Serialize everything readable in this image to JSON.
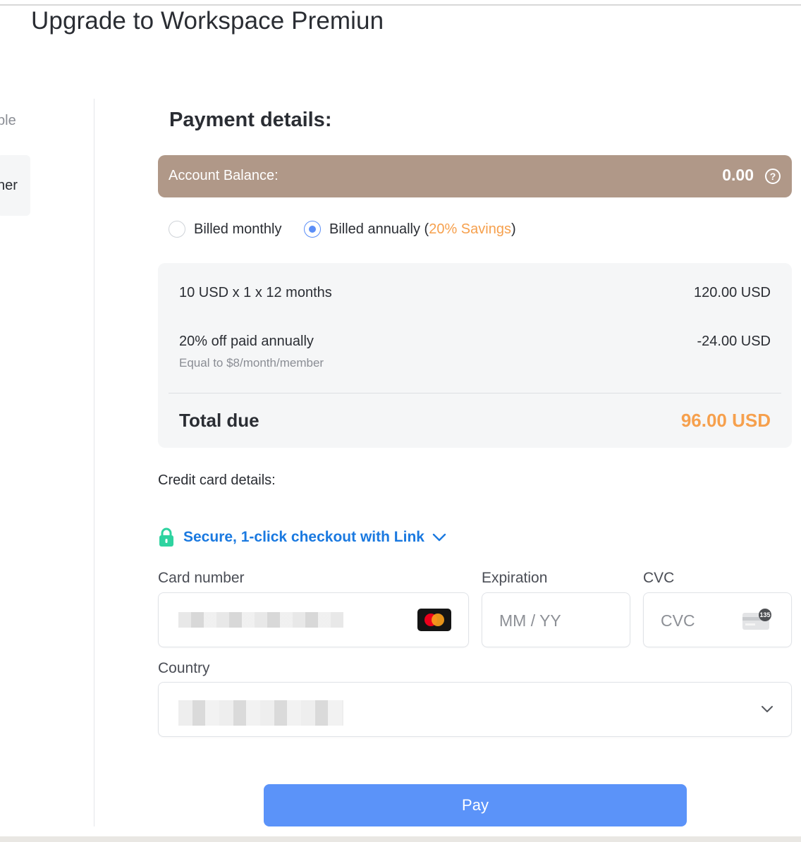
{
  "page": {
    "title": "Upgrade to Workspace Premiun"
  },
  "left_panel": {
    "items": [
      {
        "label": "ple"
      },
      {
        "label": "ner"
      }
    ]
  },
  "payment": {
    "section_title": "Payment details:",
    "account_balance": {
      "label": "Account Balance:",
      "value": "0.00",
      "help_icon": "question-circle-icon"
    },
    "billing": {
      "monthly_label": "Billed monthly",
      "annual_label": "Billed annually (",
      "annual_savings": "20% Savings",
      "annual_suffix": ")",
      "selected": "annual"
    },
    "summary": {
      "line1_label": "10 USD x 1 x 12 months",
      "line1_value": "120.00 USD",
      "line2_label": "20% off paid annually",
      "line2_sub": "Equal to $8/month/member",
      "line2_value": "-24.00 USD",
      "total_label": "Total due",
      "total_value": "96.00 USD"
    }
  },
  "credit_card": {
    "section_label": "Credit card details:",
    "link_text": "Secure, 1-click checkout with Link",
    "card_number_label": "Card number",
    "expiration_label": "Expiration",
    "expiration_placeholder": "MM / YY",
    "cvc_label": "CVC",
    "cvc_placeholder": "CVC",
    "cvc_badge": "135",
    "country_label": "Country"
  },
  "actions": {
    "pay_label": "Pay"
  },
  "colors": {
    "balance_bar": "#b09888",
    "accent_orange": "#f6a04d",
    "link_blue": "#1a79e0",
    "pay_button": "#5b93f9",
    "lock_green": "#2ed3a0"
  }
}
